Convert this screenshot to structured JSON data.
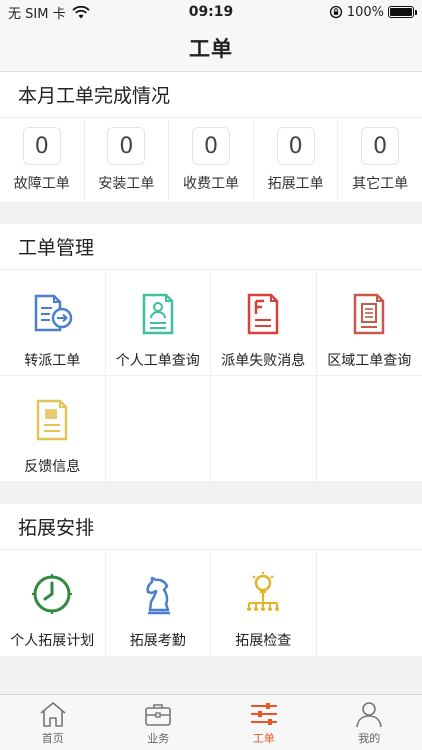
{
  "status_bar": {
    "carrier": "无 SIM 卡",
    "time": "09:19",
    "battery": "100%",
    "battery_level": 1.0
  },
  "nav": {
    "title": "工单"
  },
  "monthly": {
    "title": "本月工单完成情况",
    "stats": [
      {
        "value": "0",
        "label": "故障工单"
      },
      {
        "value": "0",
        "label": "安装工单"
      },
      {
        "value": "0",
        "label": "收费工单"
      },
      {
        "value": "0",
        "label": "拓展工单"
      },
      {
        "value": "0",
        "label": "其它工单"
      }
    ]
  },
  "management": {
    "title": "工单管理",
    "items": [
      {
        "label": "转派工单",
        "icon": "transfer-doc-icon",
        "color": "#4a7fd0"
      },
      {
        "label": "个人工单查询",
        "icon": "person-doc-icon",
        "color": "#3fbf9a"
      },
      {
        "label": "派单失败消息",
        "icon": "fail-doc-icon",
        "color": "#d9403a"
      },
      {
        "label": "区域工单查询",
        "icon": "region-doc-icon",
        "color": "#c8584a"
      },
      {
        "label": "反馈信息",
        "icon": "feedback-doc-icon",
        "color": "#e3c35a"
      }
    ]
  },
  "expansion": {
    "title": "拓展安排",
    "items": [
      {
        "label": "个人拓展计划",
        "icon": "clock-icon",
        "color": "#2f8a3e"
      },
      {
        "label": "拓展考勤",
        "icon": "knight-icon",
        "color": "#4a7fd0"
      },
      {
        "label": "拓展检查",
        "icon": "lightbulb-network-icon",
        "color": "#e3b42b"
      }
    ]
  },
  "tabs": [
    {
      "label": "首页",
      "icon": "home-icon",
      "active": false
    },
    {
      "label": "业务",
      "icon": "briefcase-icon",
      "active": false
    },
    {
      "label": "工单",
      "icon": "sliders-icon",
      "active": true
    },
    {
      "label": "我的",
      "icon": "user-icon",
      "active": false
    }
  ],
  "colors": {
    "accent": "#e8572a",
    "background": "#f2f2f2"
  }
}
